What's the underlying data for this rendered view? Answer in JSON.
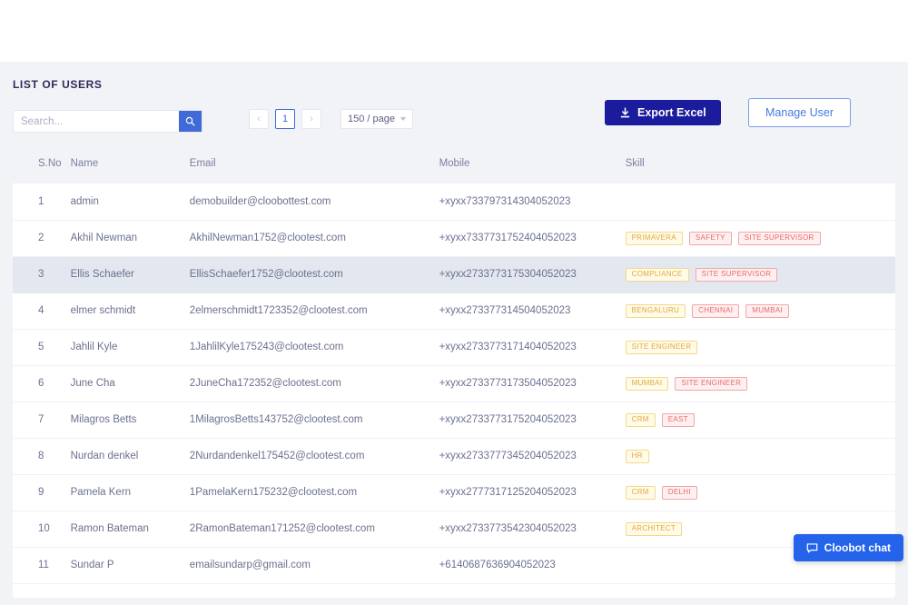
{
  "page": {
    "title": "LIST OF USERS"
  },
  "search": {
    "placeholder": "Search...",
    "value": "",
    "icon": "search-icon"
  },
  "pagination": {
    "prev_label": "‹",
    "current_page": "1",
    "next_label": "›",
    "page_size_label": "150 / page",
    "caret_icon": "chevron-down-icon"
  },
  "actions": {
    "export_label": "Export Excel",
    "export_icon": "download-icon",
    "export_color": "#1b1b9e",
    "manage_label": "Manage User",
    "manage_color": "#4a78e0"
  },
  "table": {
    "columns": [
      "S.No",
      "Name",
      "Email",
      "Mobile",
      "Skill"
    ],
    "rows": [
      {
        "sno": "1",
        "name": "admin",
        "email": "demobuilder@cloobottest.com",
        "mobile": "+xyxx733797314304052023",
        "skills": [],
        "highlight": false
      },
      {
        "sno": "2",
        "name": "Akhil Newman",
        "email": "AkhilNewman1752@clootest.com",
        "mobile": "+xyxx7337731752404052023",
        "skills": [
          "PRIMAVERA",
          "SAFETY",
          "SITE SUPERVISOR"
        ],
        "highlight": false
      },
      {
        "sno": "3",
        "name": "Ellis Schaefer",
        "email": "EllisSchaefer1752@clootest.com",
        "mobile": "+xyxx2733773175304052023",
        "skills": [
          "COMPLIANCE",
          "SITE SUPERVISOR"
        ],
        "highlight": true
      },
      {
        "sno": "4",
        "name": "elmer schmidt",
        "email": "2elmerschmidt1723352@clootest.com",
        "mobile": "+xyxx273377314504052023",
        "skills": [
          "BENGALURU",
          "CHENNAI",
          "MUMBAI"
        ],
        "highlight": false
      },
      {
        "sno": "5",
        "name": "Jahlil Kyle",
        "email": "1JahlilKyle175243@clootest.com",
        "mobile": "+xyxx2733773171404052023",
        "skills": [
          "SITE ENGINEER"
        ],
        "highlight": false
      },
      {
        "sno": "6",
        "name": "June Cha",
        "email": "2JuneCha172352@clootest.com",
        "mobile": "+xyxx2733773173504052023",
        "skills": [
          "MUMBAI",
          "SITE ENGINEER"
        ],
        "highlight": false
      },
      {
        "sno": "7",
        "name": "Milagros Betts",
        "email": "1MilagrosBetts143752@clootest.com",
        "mobile": "+xyxx2733773175204052023",
        "skills": [
          "CRM",
          "EAST"
        ],
        "highlight": false
      },
      {
        "sno": "8",
        "name": "Nurdan denkel",
        "email": "2Nurdandenkel175452@clootest.com",
        "mobile": "+xyxx2733777345204052023",
        "skills": [
          "HR"
        ],
        "highlight": false
      },
      {
        "sno": "9",
        "name": "Pamela Kern",
        "email": "1PamelaKern175232@clootest.com",
        "mobile": "+xyxx2777317125204052023",
        "skills": [
          "CRM",
          "DELHI"
        ],
        "highlight": false
      },
      {
        "sno": "10",
        "name": "Ramon Bateman",
        "email": "2RamonBateman171252@clootest.com",
        "mobile": "+xyxx2733773542304052023",
        "skills": [
          "ARCHITECT"
        ],
        "highlight": false
      },
      {
        "sno": "11",
        "name": "Sundar P",
        "email": "emailsundarp@gmail.com",
        "mobile": "+6140687636904052023",
        "skills": [],
        "highlight": false
      }
    ]
  },
  "chat": {
    "label": "Cloobot chat",
    "icon": "chat-bubble-icon",
    "color": "#2563eb"
  }
}
